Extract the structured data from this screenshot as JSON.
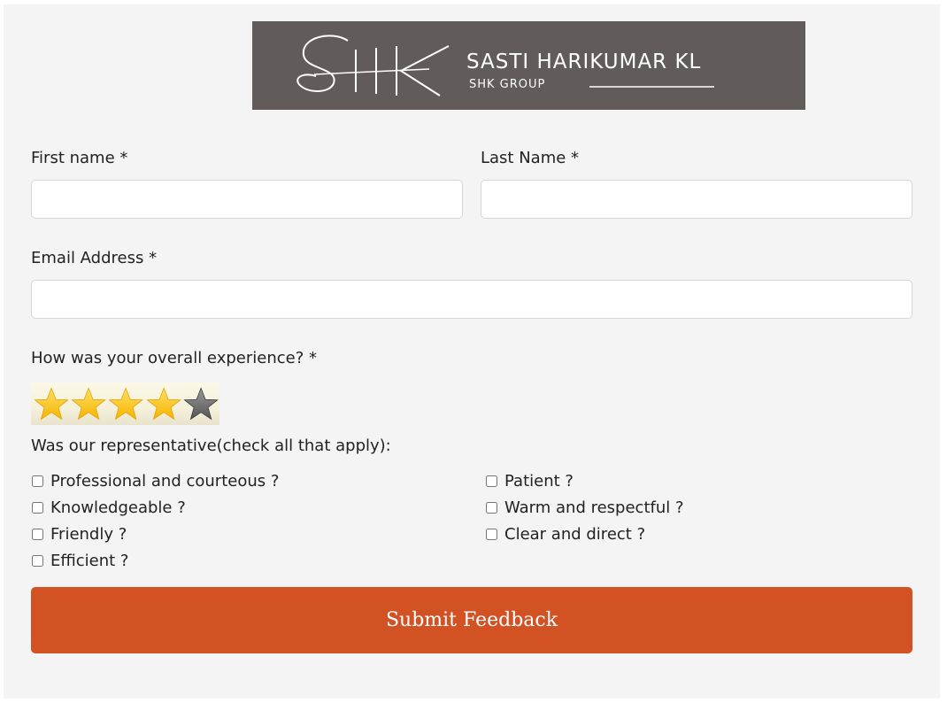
{
  "logo": {
    "monogram": "SHK",
    "brand_name": "SASTI HARIKUMAR KL",
    "brand_sub": "SHK GROUP"
  },
  "form": {
    "first_name_label": "First name *",
    "first_name_value": "",
    "last_name_label": "Last Name *",
    "last_name_value": "",
    "email_label": "Email Address *",
    "email_value": "",
    "experience_label": "How was your overall experience? *",
    "rating": {
      "value": 4,
      "max": 5
    },
    "representative_label": "Was our representative(check all that apply):",
    "checkboxes_left": [
      {
        "label": "Professional and courteous ?",
        "checked": false
      },
      {
        "label": "Knowledgeable ?",
        "checked": false
      },
      {
        "label": "Friendly ?",
        "checked": false
      },
      {
        "label": "Efficient ?",
        "checked": false
      }
    ],
    "checkboxes_right": [
      {
        "label": "Patient ?",
        "checked": false
      },
      {
        "label": "Warm and respectful ?",
        "checked": false
      },
      {
        "label": "Clear and direct ?",
        "checked": false
      }
    ],
    "submit_label": "Submit Feedback"
  },
  "colors": {
    "banner_bg": "#615c59",
    "accent": "#d35224",
    "star_filled": "#f6b400",
    "star_empty": "#555555",
    "card_bg": "#f4f4f4"
  }
}
